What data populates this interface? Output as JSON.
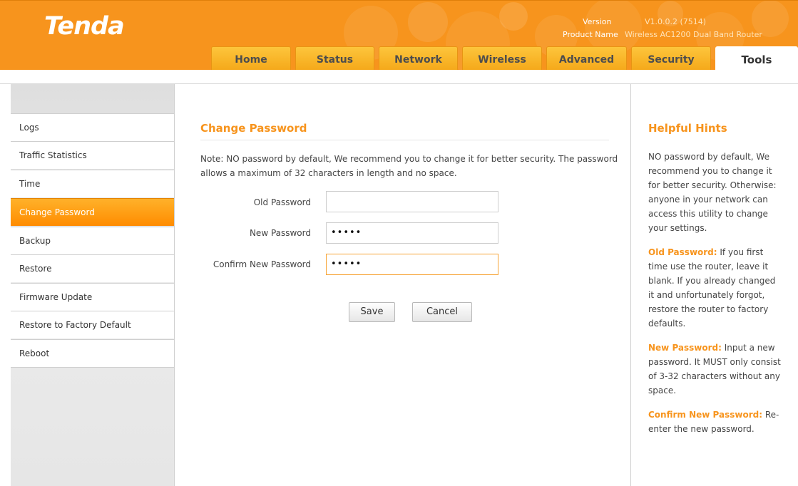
{
  "header": {
    "logo": "Tenda",
    "version_label": "Version",
    "version_value": "V1.0.0.2 (7514)",
    "product_label": "Product Name",
    "product_value": "Wireless AC1200 Dual Band Router"
  },
  "tabs": [
    "Home",
    "Status",
    "Network",
    "Wireless",
    "Advanced",
    "Security",
    "Tools"
  ],
  "active_tab": "Tools",
  "sidebar": {
    "items": [
      "Logs",
      "Traffic Statistics",
      "Time",
      "Change Password",
      "Backup",
      "Restore",
      "Firmware Update",
      "Restore to Factory Default",
      "Reboot"
    ],
    "active": "Change Password"
  },
  "main": {
    "title": "Change Password",
    "note": "Note: NO password by default, We recommend you to change it for better security. The password allows a maximum of 32 characters in length and no space.",
    "old_password_label": "Old Password",
    "old_password_value": "",
    "new_password_label": "New Password",
    "new_password_value": "•••••",
    "confirm_password_label": "Confirm New Password",
    "confirm_password_value": "•••••",
    "save_label": "Save",
    "cancel_label": "Cancel"
  },
  "hints": {
    "title": "Helpful Hints",
    "intro": "NO password by default, We recommend you to change it for better security. Otherwise: anyone in your network can access this utility to change your settings.",
    "old_key": "Old Password:",
    "old_text": " If you first time use the router, leave it blank. If you already changed it and unfortunately forgot, restore the router to factory defaults.",
    "new_key": "New Password:",
    "new_text": " Input a new password. It MUST only consist of 3-32 characters without any space.",
    "confirm_key": "Confirm New Password:",
    "confirm_text": " Re-enter the new password."
  },
  "colors": {
    "brand_orange": "#f7941d",
    "tab_yellow": "#fdc53c",
    "sidebar_active": "#ff9a10"
  }
}
